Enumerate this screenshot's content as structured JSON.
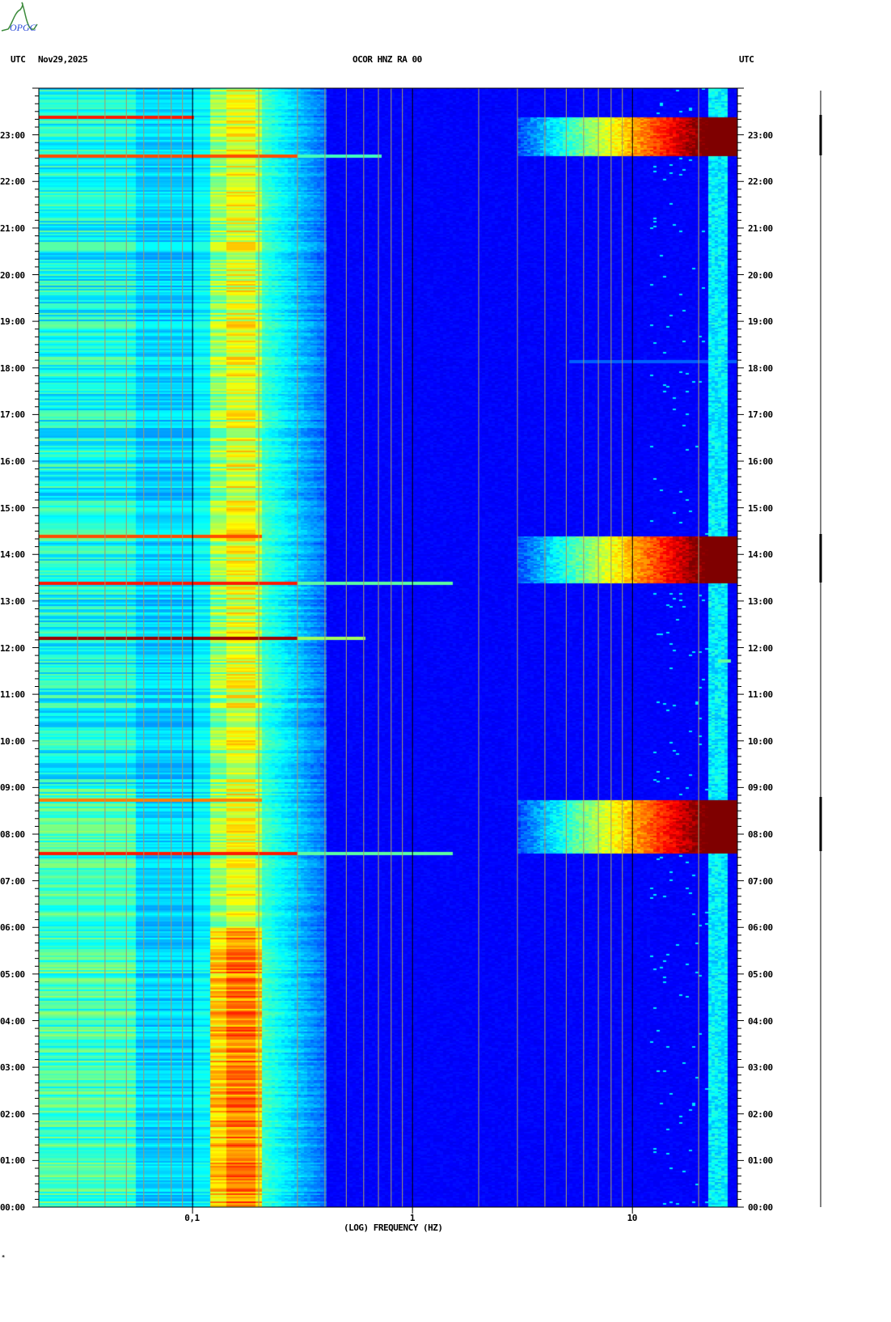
{
  "header": {
    "left_tz": "UTC",
    "date": "Nov29,2025",
    "station": "OCOR HNZ RA 00",
    "right_tz": "UTC",
    "logo_text": "OPGC"
  },
  "footer_mark": "*",
  "chart_data": {
    "type": "heatmap",
    "title": "OCOR HNZ RA 00",
    "xlabel": "(LOG) FREQUENCY (HZ)",
    "ylabel": "UTC",
    "xscale": "log",
    "xlim": [
      0.02,
      30
    ],
    "ylim_hours": [
      0,
      24
    ],
    "x_tick_labels": [
      {
        "value": 0.1,
        "label": "0,1"
      },
      {
        "value": 1,
        "label": "1"
      },
      {
        "value": 10,
        "label": "10"
      }
    ],
    "y_tick_labels": [
      "00:00",
      "01:00",
      "02:00",
      "03:00",
      "04:00",
      "05:00",
      "06:00",
      "07:00",
      "08:00",
      "09:00",
      "10:00",
      "11:00",
      "12:00",
      "13:00",
      "14:00",
      "15:00",
      "16:00",
      "17:00",
      "18:00",
      "19:00",
      "20:00",
      "21:00",
      "22:00",
      "23:00"
    ],
    "colormap": "jet",
    "microseism_band_hz": [
      0.12,
      0.2
    ],
    "high_freq_noise_band_hz": [
      22,
      27
    ],
    "events": [
      {
        "start_h": 22.55,
        "end_h": 23.4,
        "fmin_hz": 3,
        "intensity": 1.0
      },
      {
        "start_h": 13.4,
        "end_h": 14.4,
        "fmin_hz": 3,
        "intensity": 1.0
      },
      {
        "start_h": 7.6,
        "end_h": 8.75,
        "fmin_hz": 3,
        "intensity": 1.0
      }
    ],
    "lines": [
      {
        "time_h": 23.4,
        "fmax_hz": 0.1,
        "intensity": 0.85
      },
      {
        "time_h": 22.55,
        "fmax_hz": 0.7,
        "intensity": 0.8
      },
      {
        "time_h": 14.4,
        "fmax_hz": 0.2,
        "intensity": 0.8
      },
      {
        "time_h": 13.4,
        "fmax_hz": 1.5,
        "intensity": 0.85
      },
      {
        "time_h": 12.22,
        "fmax_hz": 0.6,
        "intensity": 0.97
      },
      {
        "time_h": 8.75,
        "fmax_hz": 0.2,
        "intensity": 0.75
      },
      {
        "time_h": 7.6,
        "fmax_hz": 1.5,
        "intensity": 0.85
      },
      {
        "time_h": 18.15,
        "fmin_hz": 5,
        "fmax_hz": 30,
        "intensity": 0.4
      },
      {
        "time_h": 11.72,
        "fmin_hz": 24,
        "fmax_hz": 28,
        "intensity": 0.85
      }
    ]
  }
}
